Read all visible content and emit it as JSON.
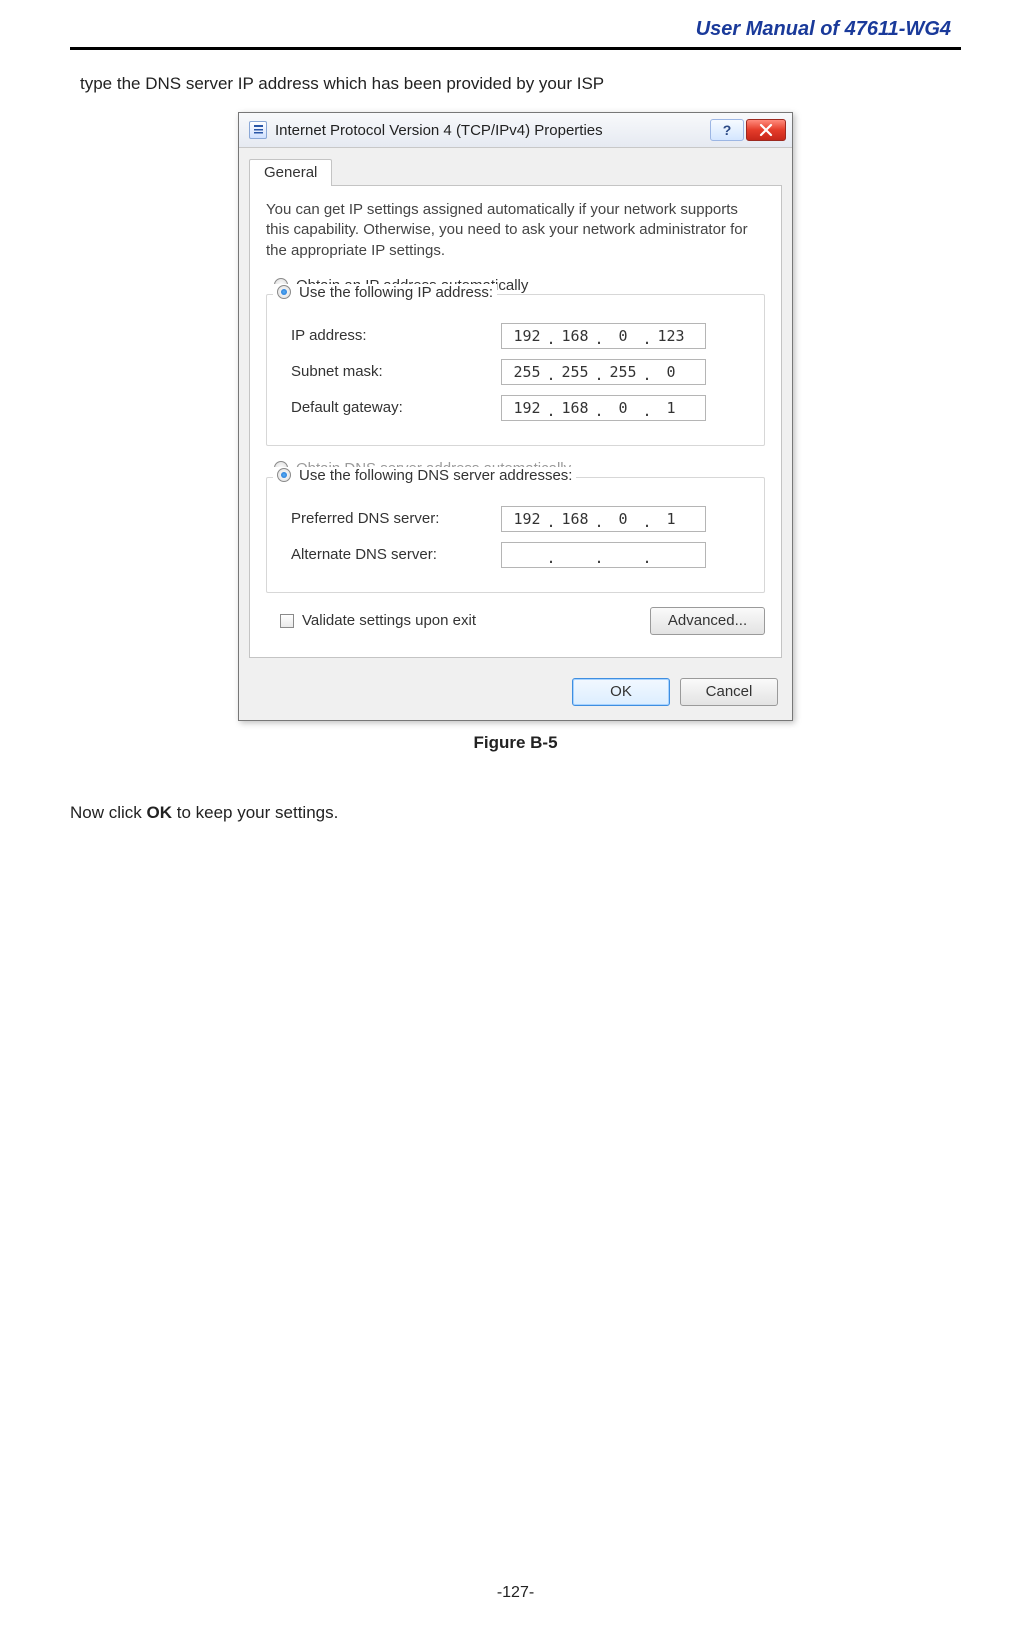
{
  "header": {
    "title": "User Manual of 47611-WG4"
  },
  "intro": "type the DNS server IP address which has been provided by your ISP",
  "figure_caption": "Figure B-5",
  "after_text_pre": "Now click ",
  "after_text_bold": "OK",
  "after_text_post": " to keep your settings.",
  "page_number": "-127-",
  "dialog": {
    "title": "Internet Protocol Version 4 (TCP/IPv4) Properties",
    "help_glyph": "?",
    "tab": "General",
    "description": "You can get IP settings assigned automatically if your network supports this capability. Otherwise, you need to ask your network administrator for the appropriate IP settings.",
    "ip_group": {
      "auto_label": "Obtain an IP address automatically",
      "manual_label": "Use the following IP address:",
      "rows": {
        "ip": {
          "label": "IP address:",
          "octets": [
            "192",
            "168",
            "0",
            "123"
          ]
        },
        "mask": {
          "label": "Subnet mask:",
          "octets": [
            "255",
            "255",
            "255",
            "0"
          ]
        },
        "gw": {
          "label": "Default gateway:",
          "octets": [
            "192",
            "168",
            "0",
            "1"
          ]
        }
      }
    },
    "dns_group": {
      "auto_label": "Obtain DNS server address automatically",
      "manual_label": "Use the following DNS server addresses:",
      "rows": {
        "pref": {
          "label": "Preferred DNS server:",
          "octets": [
            "192",
            "168",
            "0",
            "1"
          ]
        },
        "alt": {
          "label": "Alternate DNS server:",
          "octets": [
            "",
            "",
            "",
            ""
          ]
        }
      }
    },
    "validate_label": "Validate settings upon exit",
    "advanced_label": "Advanced...",
    "ok_label": "OK",
    "cancel_label": "Cancel"
  }
}
